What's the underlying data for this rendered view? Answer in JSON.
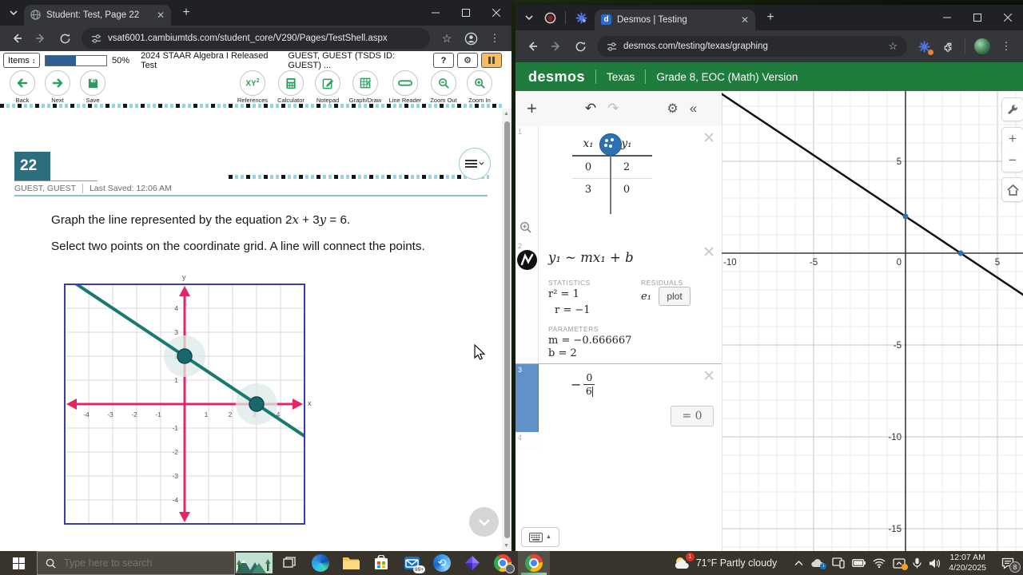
{
  "left_window": {
    "tab_title": "Student: Test, Page 22",
    "url": "vsat6001.cambiumtds.com/student_core/V290/Pages/TestShell.aspx",
    "test_toolbar": {
      "items_label": "Items",
      "progress_label": "50%",
      "test_name": "2024 STAAR Algebra I Released Test",
      "user_info": "GUEST, GUEST (TSDS ID: GUEST) ...",
      "help_label": "?"
    },
    "nav": {
      "back": "Back",
      "next": "Next",
      "save": "Save",
      "references": "References",
      "references_icon_xy": "XY",
      "references_icon_sup": "2",
      "calculator": "Calculator",
      "notepad": "Notepad",
      "graphdraw": "Graph/Draw",
      "linereader": "Line Reader",
      "zoomout": "Zoom Out",
      "zoomin": "Zoom In"
    },
    "item": {
      "number": "22",
      "user": "GUEST, GUEST",
      "last_saved": "Last Saved: 12:06 AM",
      "q1a": "Graph the line represented by the equation 2",
      "q1_var1": "x",
      "q1b": " + 3",
      "q1_var2": "y",
      "q1c": " = 6.",
      "q2": "Select two points on the coordinate grid. A line will connect the points."
    }
  },
  "right_window": {
    "tab_title": "Desmos | Testing",
    "favicon_letter": "d",
    "url": "desmos.com/testing/texas/graphing",
    "header": {
      "logo": "desmos",
      "region": "Texas",
      "version": "Grade 8, EOC (Math) Version"
    },
    "expressions": {
      "e1": {
        "index": "1",
        "col1": "x₁",
        "col2": "y₁",
        "rows": [
          [
            "0",
            "2"
          ],
          [
            "3",
            "0"
          ]
        ]
      },
      "e2": {
        "index": "2",
        "formula": "y₁ ~ mx₁ + b",
        "stats_label": "STATISTICS",
        "r2": "r² = 1",
        "r": "r = −1",
        "residuals_label": "RESIDUALS",
        "evar": "e₁",
        "plot": "plot",
        "params_label": "PARAMETERS",
        "m": "m = −0.666667",
        "b": "b = 2"
      },
      "e3": {
        "index": "3",
        "sign": "−",
        "num": "0",
        "den": "6",
        "result": "= 0"
      },
      "e4": {
        "index": "4"
      }
    }
  },
  "taskbar": {
    "search_placeholder": "Type here to search",
    "mail_badge": "99+",
    "weather_badge": "1",
    "weather": "71°F Partly cloudy",
    "time": "12:07 AM",
    "date": "4/20/2025",
    "notification_count": "8"
  },
  "colors": {
    "desmos_green": "#1e7c3d",
    "staar_teal": "#2b6e80",
    "axis_pink": "#e32566",
    "line_teal": "#187a6e",
    "point_blue": "#2d70b3",
    "progress_blue": "#2e5f94"
  },
  "chart_data": [
    {
      "id": "staar-grid",
      "type": "line",
      "equation": "2x + 3y = 6",
      "line": {
        "slope": -0.6667,
        "intercept": 2,
        "color": "#187a6e",
        "width": 4
      },
      "points": [
        {
          "x": 0,
          "y": 2
        },
        {
          "x": 3,
          "y": 0
        }
      ],
      "point_color": "#17696d",
      "point_halo_color": "#dce9e7",
      "xlabel": "x",
      "ylabel": "y",
      "xlim": [
        -5,
        5
      ],
      "ylim": [
        -5,
        5
      ],
      "xticks": [
        -4,
        -3,
        -2,
        -1,
        1,
        2,
        3,
        4
      ],
      "yticks": [
        -4,
        -3,
        -2,
        -1,
        1,
        2,
        3,
        4
      ],
      "grid": true,
      "axis_color": "#e32566",
      "border_color": "#3c3cae"
    },
    {
      "id": "desmos-graph",
      "type": "line",
      "line": {
        "slope": -0.666667,
        "intercept": 2,
        "color": "#111111",
        "width": 2.5
      },
      "points": [
        {
          "x": 0,
          "y": 2
        },
        {
          "x": 3,
          "y": 0
        }
      ],
      "point_color": "#2d70b3",
      "xlim": [
        -10,
        6.4
      ],
      "ylim": [
        -16.2,
        8.8
      ],
      "xtick_labels": [
        -10,
        -5,
        0,
        5
      ],
      "ytick_labels": [
        5,
        -5,
        -10,
        -15
      ],
      "tick_step": 5,
      "grid": true
    }
  ]
}
